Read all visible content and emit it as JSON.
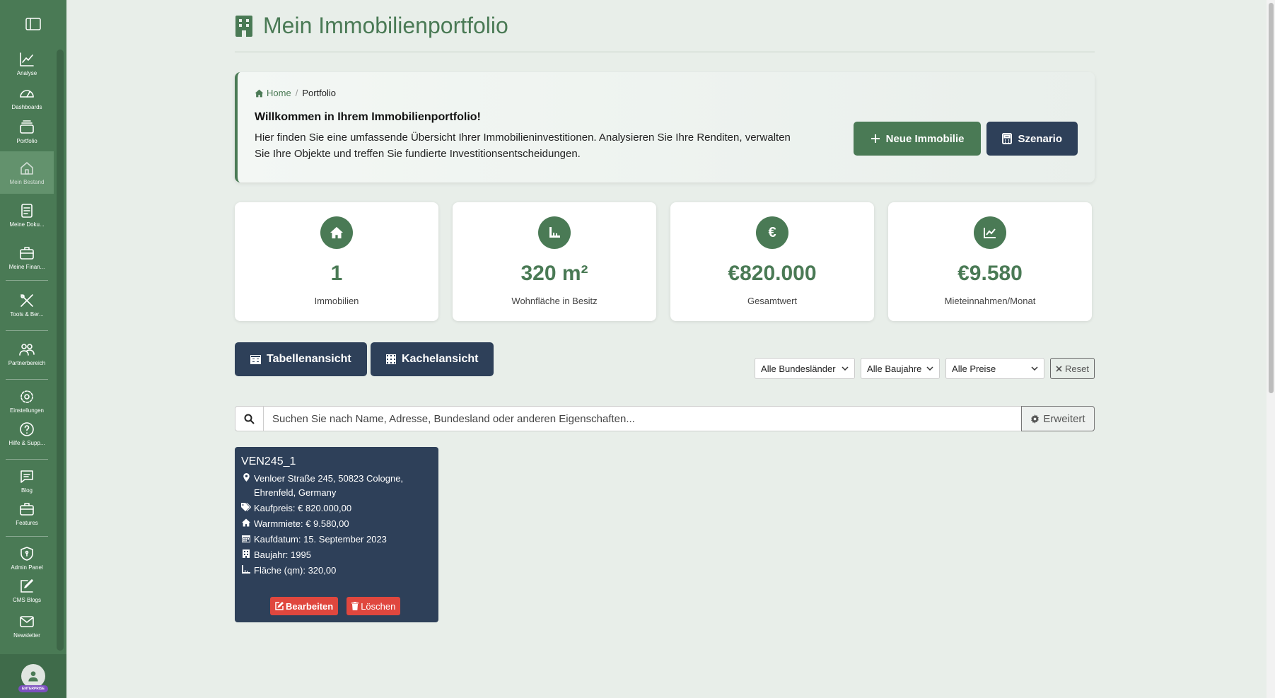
{
  "sidebar": {
    "items": [
      {
        "label": "Analyse",
        "icon": "chart-line-icon"
      },
      {
        "label": "Dashboards",
        "icon": "gauge-icon"
      },
      {
        "label": "Portfolio",
        "icon": "stack-icon"
      },
      {
        "label": "Mein Bestand",
        "icon": "house-icon",
        "active": true
      },
      {
        "label": "Meine Doku...",
        "icon": "document-icon"
      },
      {
        "label": "Meine Finan...",
        "icon": "briefcase-icon"
      },
      {
        "label": "Tools & Ber...",
        "icon": "tools-icon"
      },
      {
        "label": "Partnerbereich",
        "icon": "users-icon"
      },
      {
        "label": "Einstellungen",
        "icon": "gear-icon"
      },
      {
        "label": "Hilfe & Supp...",
        "icon": "help-icon"
      },
      {
        "label": "Blog",
        "icon": "message-icon"
      },
      {
        "label": "Features",
        "icon": "briefcase-icon"
      },
      {
        "label": "Admin Panel",
        "icon": "shield-icon"
      },
      {
        "label": "CMS Blogs",
        "icon": "edit-icon"
      },
      {
        "label": "Newsletter",
        "icon": "mail-icon"
      }
    ],
    "badge": "ENTERPRISE"
  },
  "header": {
    "title": "Mein Immobilienportfolio"
  },
  "breadcrumb": {
    "home": "Home",
    "current": "Portfolio"
  },
  "welcome": {
    "title": "Willkommen in Ihrem Immobilienportfolio!",
    "text": "Hier finden Sie eine umfassende Übersicht Ihrer Immobilieninvestitionen. Analysieren Sie Ihre Renditen, verwalten Sie Ihre Objekte und treffen Sie fundierte Investitionsentscheidungen.",
    "new_button": "Neue Immobilie",
    "scenario_button": "Szenario"
  },
  "stats": [
    {
      "value": "1",
      "label": "Immobilien",
      "icon": "home-icon"
    },
    {
      "value": "320 m²",
      "label": "Wohnfläche in Besitz",
      "icon": "ruler-icon"
    },
    {
      "value": "€820.000",
      "label": "Gesamtwert",
      "icon": "euro-icon"
    },
    {
      "value": "€9.580",
      "label": "Mieteinnahmen/Monat",
      "icon": "chart-icon"
    }
  ],
  "views": {
    "table": "Tabellenansicht",
    "tiles": "Kachelansicht"
  },
  "filters": {
    "state": "Alle Bundesländer",
    "year": "Alle Baujahre",
    "price": "Alle Preise",
    "reset": "Reset"
  },
  "search": {
    "placeholder": "Suchen Sie nach Name, Adresse, Bundesland oder anderen Eigenschaften...",
    "advanced": "Erweitert"
  },
  "property": {
    "name": "VEN245_1",
    "address": "Venloer Straße 245, 50823 Cologne, Ehrenfeld, Germany",
    "price": "Kaufpreis: € 820.000,00",
    "rent": "Warmmiete: € 9.580,00",
    "date": "Kaufdatum: 15. September 2023",
    "year": "Baujahr: 1995",
    "area": "Fläche (qm): 320,00",
    "edit": "Bearbeiten",
    "delete": "Löschen"
  },
  "colors": {
    "primary": "#4a7a55",
    "dark": "#2e4059",
    "danger": "#e0473e",
    "background": "#e8eee9"
  }
}
